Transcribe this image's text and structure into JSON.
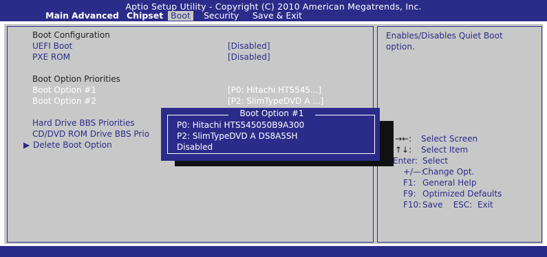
{
  "header": {
    "title": "Aptio Setup Utility - Copyright (C) 2010 American Megatrends, Inc.",
    "tabs": [
      {
        "label": "Main"
      },
      {
        "label": "Advanced"
      },
      {
        "label": "Chipset"
      },
      {
        "label": "Boot"
      },
      {
        "label": "Security"
      },
      {
        "label": "Save & Exit"
      }
    ]
  },
  "boot": {
    "config_heading": "Boot Configuration",
    "uefi_label": "UEFI Boot",
    "uefi_value": "[Disabled]",
    "pxe_label": "PXE ROM",
    "pxe_value": "[Disabled]",
    "priorities_heading": "Boot Option Priorities",
    "option1_label": "Boot Option #1",
    "option1_value": "[P0:  Hitachi HTS545...]",
    "option2_label": "Boot Option #2",
    "option2_value": "[P2:  SlimTypeDVD A ...]",
    "hdd_bbs_label": "Hard Drive BBS Priorities",
    "cd_bbs_label": "CD/DVD ROM Drive BBS Prio",
    "delete_arrow": "▶",
    "delete_label": "Delete Boot Option"
  },
  "popup": {
    "title": "Boot Option #1",
    "options": [
      "P0:  Hitachi HTS545050B9A300",
      "P2:  SlimTypeDVD A DS8A5SH",
      "Disabled"
    ]
  },
  "help": {
    "description": "Enables/Disables Quiet Boot option.",
    "keys": [
      {
        "key": "→←:",
        "desc": "Select Screen"
      },
      {
        "key": "↑↓:",
        "desc": "Select Item"
      },
      {
        "key": "Enter:",
        "desc": "Select"
      },
      {
        "key": "+/—:",
        "desc": "Change Opt."
      },
      {
        "key": "F1:",
        "desc": "General Help"
      },
      {
        "key": "F9:",
        "desc": "Optimized Defaults"
      },
      {
        "key": "F10:",
        "desc": "Save    ESC:  Exit"
      }
    ]
  },
  "colors": {
    "bios_blue": "#2b2b8a",
    "panel_gray": "#c8c8c8"
  }
}
